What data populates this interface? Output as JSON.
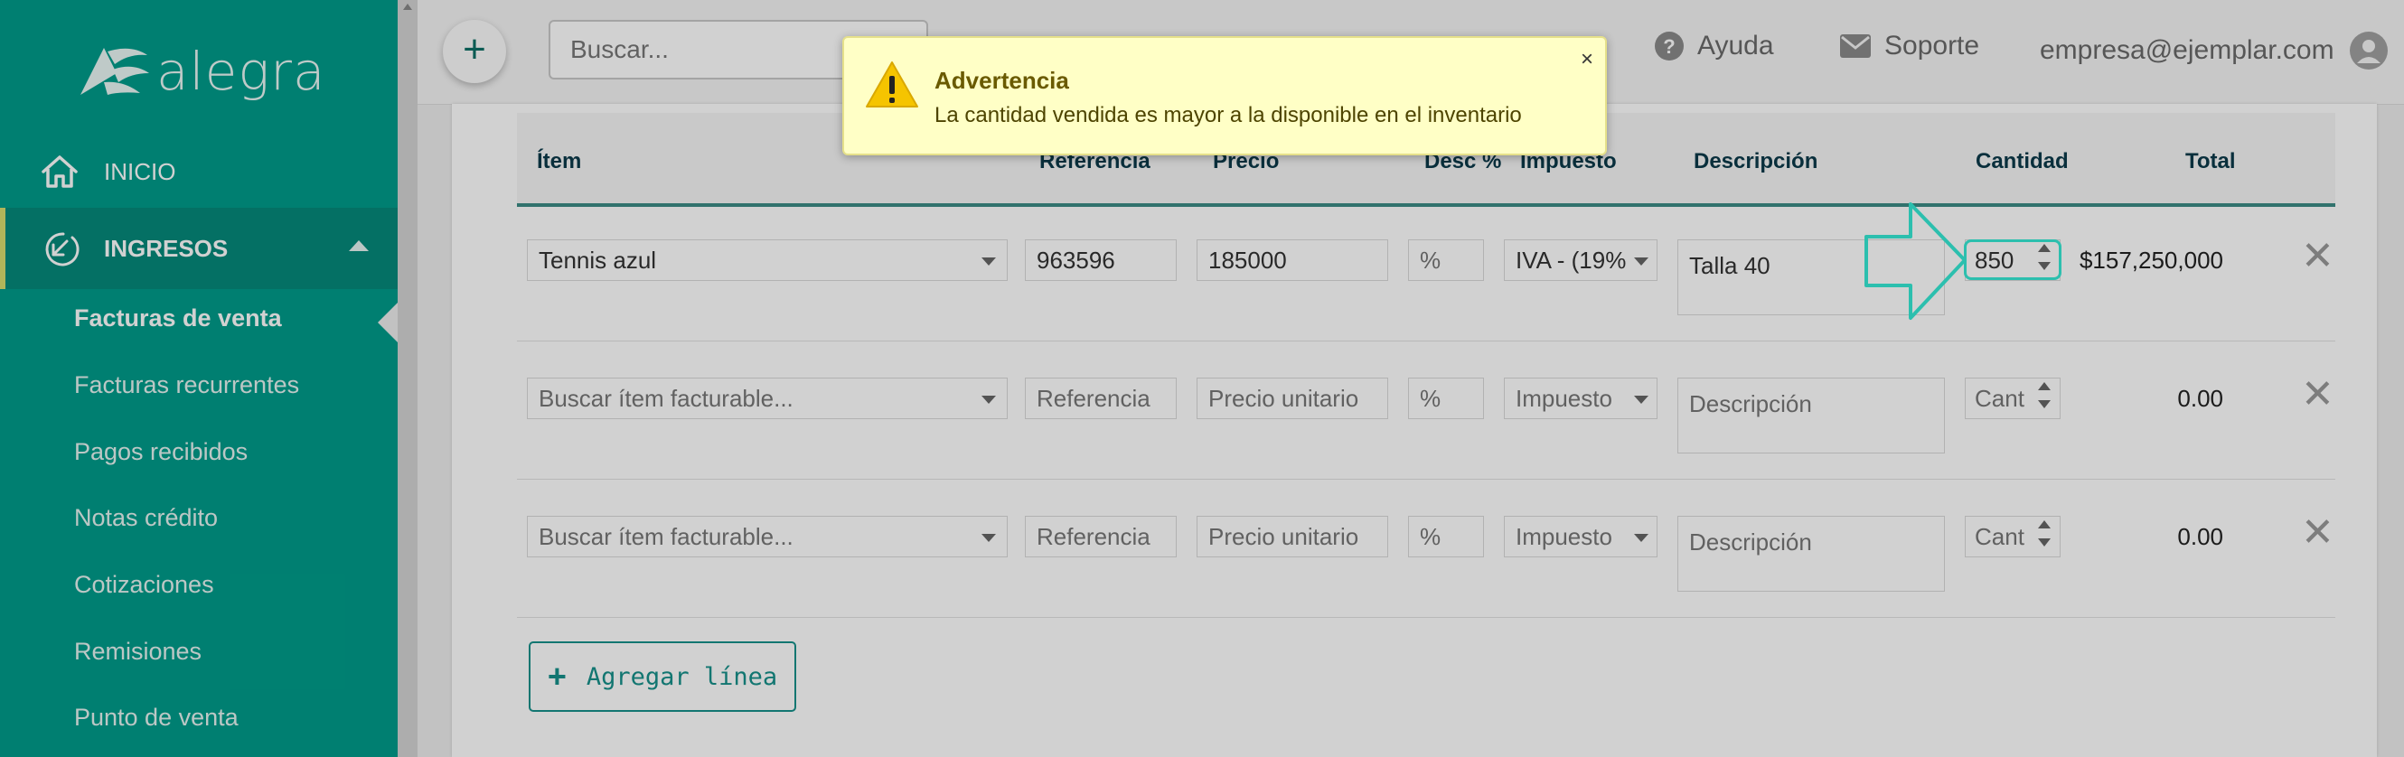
{
  "sidebar": {
    "logo_text": "alegra",
    "nav": {
      "inicio": "INICIO",
      "ingresos": "INGRESOS"
    },
    "sub_items": [
      "Facturas de venta",
      "Facturas recurrentes",
      "Pagos recibidos",
      "Notas crédito",
      "Cotizaciones",
      "Remisiones",
      "Punto de venta"
    ],
    "active_sub_item": "Facturas de venta"
  },
  "topbar": {
    "add_label": "+",
    "search_placeholder": "Buscar...",
    "help_label": "Ayuda",
    "support_label": "Soporte",
    "user_email": "empresa@ejemplar.com"
  },
  "table": {
    "headers": {
      "item": "Ítem",
      "referencia": "Referencia",
      "precio": "Precio",
      "desc": "Desc %",
      "impuesto": "Impuesto",
      "descripcion": "Descripción",
      "cantidad": "Cantidad",
      "total": "Total"
    },
    "rows": [
      {
        "item": "Tennis azul",
        "referencia": "963596",
        "precio": "185000",
        "desc": "%",
        "impuesto": "IVA - (19%",
        "descripcion": "Talla 40",
        "cantidad": "850",
        "total": "$157,250,000"
      },
      {
        "item": "Buscar ítem facturable...",
        "referencia": "Referencia",
        "precio": "Precio unitario",
        "desc": "%",
        "impuesto": "Impuesto",
        "descripcion": "Descripción",
        "cantidad": "Cant",
        "total": "0.00"
      },
      {
        "item": "Buscar ítem facturable...",
        "referencia": "Referencia",
        "precio": "Precio unitario",
        "desc": "%",
        "impuesto": "Impuesto",
        "descripcion": "Descripción",
        "cantidad": "Cant",
        "total": "0.00"
      }
    ],
    "add_line_label": "Agregar línea"
  },
  "toast": {
    "title": "Advertencia",
    "message": "La cantidad vendida es mayor a la disponible en el inventario",
    "close_label": "×"
  },
  "colors": {
    "sidebar": "#009c8a",
    "accent": "#17908a",
    "warning_bg": "#ffffc6",
    "annotation": "#2cbfae"
  }
}
